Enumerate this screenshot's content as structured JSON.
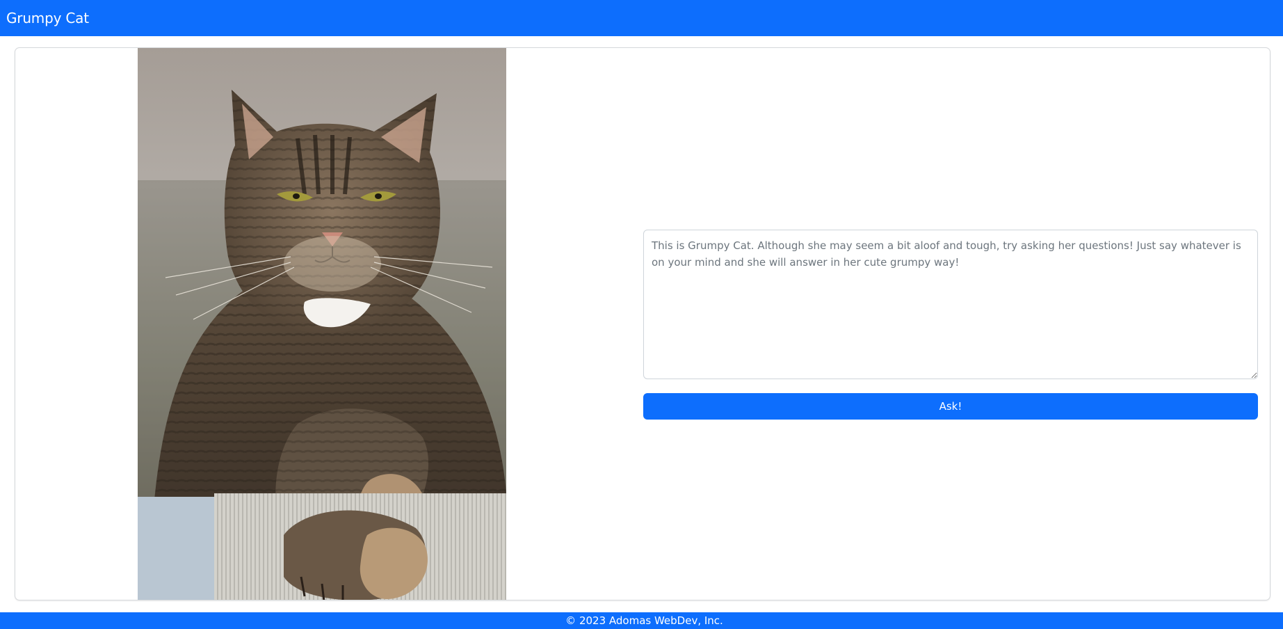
{
  "navbar": {
    "brand": "Grumpy Cat"
  },
  "image": {
    "alt": "Grumpy Cat"
  },
  "question": {
    "placeholder": "This is Grumpy Cat. Although she may seem a bit aloof and tough, try asking her questions! Just say whatever is on your mind and she will answer in her cute grumpy way!",
    "value": ""
  },
  "ask_button": {
    "label": "Ask!"
  },
  "footer": {
    "text": "© 2023 Adomas WebDev, Inc."
  },
  "colors": {
    "primary": "#0d6efd",
    "border": "#ced4da",
    "placeholder": "#6c757d"
  }
}
